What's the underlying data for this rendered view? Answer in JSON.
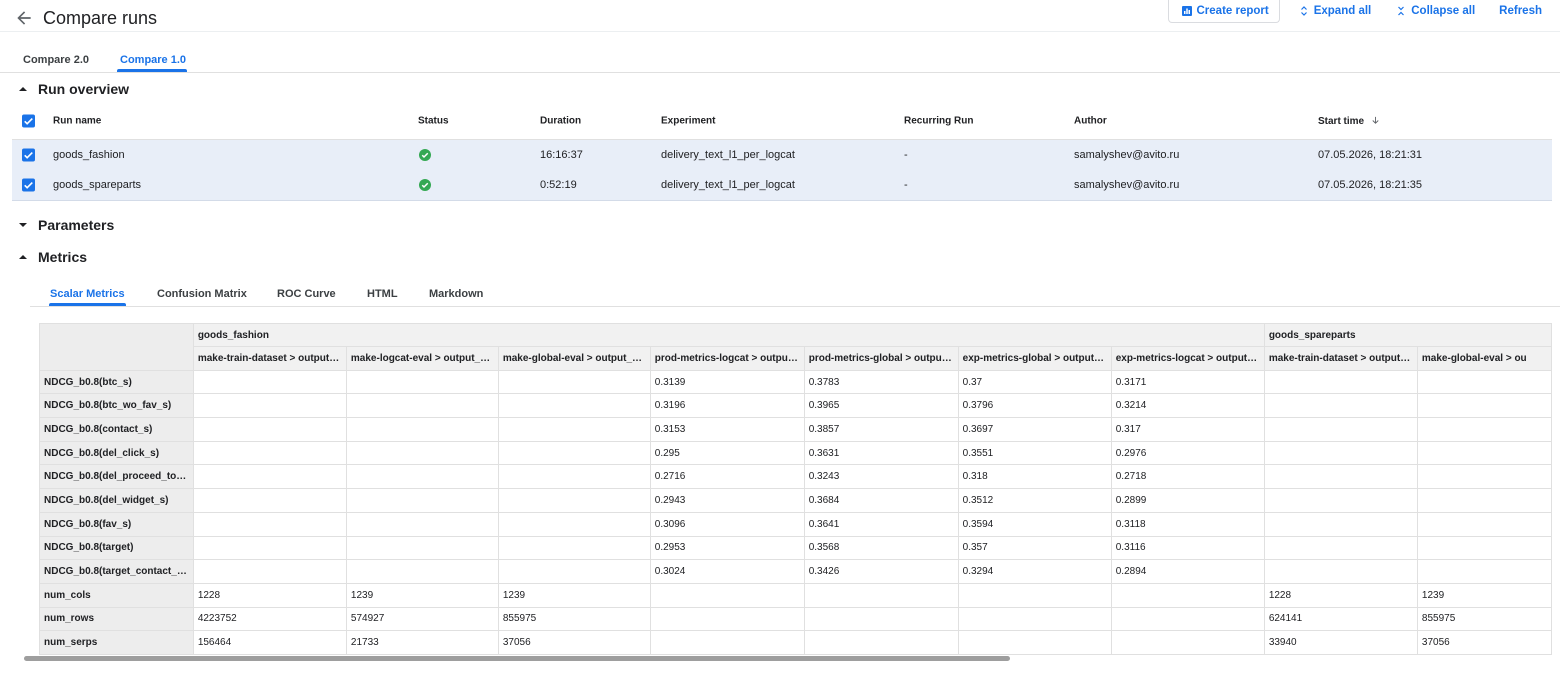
{
  "header": {
    "title": "Compare runs",
    "actions": {
      "create_report": "Create report",
      "expand_all": "Expand all",
      "collapse_all": "Collapse all",
      "refresh": "Refresh"
    }
  },
  "compare_tabs": [
    "Compare 2.0",
    "Compare 1.0"
  ],
  "active_compare_tab": "Compare 1.0",
  "sections": {
    "run_overview": "Run overview",
    "parameters": "Parameters",
    "metrics": "Metrics"
  },
  "run_overview": {
    "columns": {
      "run_name": "Run name",
      "status": "Status",
      "duration": "Duration",
      "experiment": "Experiment",
      "recurring_run": "Recurring Run",
      "author": "Author",
      "start_time": "Start time"
    },
    "rows": [
      {
        "run_name": "goods_fashion",
        "status": "succeeded",
        "duration": "16:16:37",
        "experiment": "delivery_text_l1_per_logcat",
        "recurring_run": "-",
        "author": "samalyshev@avito.ru",
        "start_time": "07.05.2026, 18:21:31"
      },
      {
        "run_name": "goods_spareparts",
        "status": "succeeded",
        "duration": "0:52:19",
        "experiment": "delivery_text_l1_per_logcat",
        "recurring_run": "-",
        "author": "samalyshev@avito.ru",
        "start_time": "07.05.2026, 18:21:35"
      }
    ]
  },
  "metrics_tabs": [
    "Scalar Metrics",
    "Confusion Matrix",
    "ROC Curve",
    "HTML",
    "Markdown"
  ],
  "active_metrics_tab": "Scalar Metrics",
  "scalar_metrics": {
    "groups": [
      {
        "name": "goods_fashion",
        "span": 7
      },
      {
        "name": "goods_spareparts",
        "span": 2
      }
    ],
    "columns": [
      "make-train-dataset > output…",
      "make-logcat-eval > output_…",
      "make-global-eval > output_…",
      "prod-metrics-logcat > outpu…",
      "prod-metrics-global > outpu…",
      "exp-metrics-global > output…",
      "exp-metrics-logcat > output…",
      "make-train-dataset > output…",
      "make-global-eval > ou"
    ],
    "rows": [
      {
        "label": "NDCG_b0.8(btc_s)",
        "values": [
          "",
          "",
          "",
          "0.3139",
          "0.3783",
          "0.37",
          "0.3171",
          "",
          ""
        ]
      },
      {
        "label": "NDCG_b0.8(btc_wo_fav_s)",
        "values": [
          "",
          "",
          "",
          "0.3196",
          "0.3965",
          "0.3796",
          "0.3214",
          "",
          ""
        ]
      },
      {
        "label": "NDCG_b0.8(contact_s)",
        "values": [
          "",
          "",
          "",
          "0.3153",
          "0.3857",
          "0.3697",
          "0.317",
          "",
          ""
        ]
      },
      {
        "label": "NDCG_b0.8(del_click_s)",
        "values": [
          "",
          "",
          "",
          "0.295",
          "0.3631",
          "0.3551",
          "0.2976",
          "",
          ""
        ]
      },
      {
        "label": "NDCG_b0.8(del_proceed_to…",
        "values": [
          "",
          "",
          "",
          "0.2716",
          "0.3243",
          "0.318",
          "0.2718",
          "",
          ""
        ]
      },
      {
        "label": "NDCG_b0.8(del_widget_s)",
        "values": [
          "",
          "",
          "",
          "0.2943",
          "0.3684",
          "0.3512",
          "0.2899",
          "",
          ""
        ]
      },
      {
        "label": "NDCG_b0.8(fav_s)",
        "values": [
          "",
          "",
          "",
          "0.3096",
          "0.3641",
          "0.3594",
          "0.3118",
          "",
          ""
        ]
      },
      {
        "label": "NDCG_b0.8(target)",
        "values": [
          "",
          "",
          "",
          "0.2953",
          "0.3568",
          "0.357",
          "0.3116",
          "",
          ""
        ]
      },
      {
        "label": "NDCG_b0.8(target_contact_…",
        "values": [
          "",
          "",
          "",
          "0.3024",
          "0.3426",
          "0.3294",
          "0.2894",
          "",
          ""
        ]
      },
      {
        "label": "num_cols",
        "values": [
          "1228",
          "1239",
          "1239",
          "",
          "",
          "",
          "",
          "1228",
          "1239"
        ]
      },
      {
        "label": "num_rows",
        "values": [
          "4223752",
          "574927",
          "855975",
          "",
          "",
          "",
          "",
          "624141",
          "855975"
        ]
      },
      {
        "label": "num_serps",
        "values": [
          "156464",
          "21733",
          "37056",
          "",
          "",
          "",
          "",
          "33940",
          "37056"
        ]
      }
    ]
  },
  "colors": {
    "accent": "#1a73e8",
    "selected_row": "#e8eef8",
    "success": "#34a853"
  }
}
